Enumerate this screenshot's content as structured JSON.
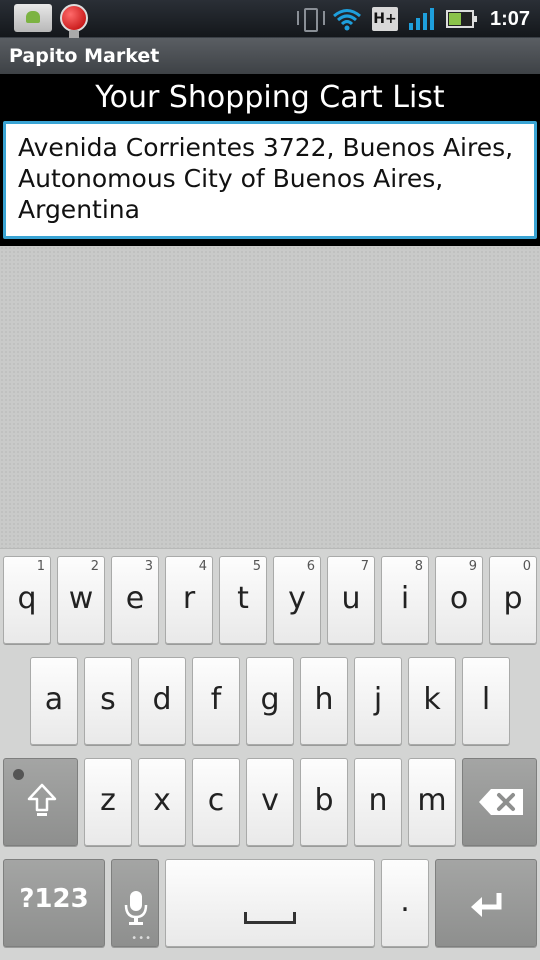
{
  "status_bar": {
    "notification_icons": [
      "photo-icon",
      "globe-icon"
    ],
    "system_icons": [
      "vibrate-icon",
      "wifi-icon",
      "network-type-icon",
      "signal-icon",
      "battery-icon"
    ],
    "network_type": "H+",
    "time": "1:07"
  },
  "app": {
    "title": "Papito Market"
  },
  "main": {
    "page_title": "Your Shopping Cart List",
    "address_lines": [
      "Avenida Corrientes 3722, Buenos Aires,",
      "Autonomous City of Buenos Aires,",
      "Argentina"
    ]
  },
  "keyboard": {
    "row1": [
      {
        "label": "q",
        "hint": "1"
      },
      {
        "label": "w",
        "hint": "2"
      },
      {
        "label": "e",
        "hint": "3"
      },
      {
        "label": "r",
        "hint": "4"
      },
      {
        "label": "t",
        "hint": "5"
      },
      {
        "label": "y",
        "hint": "6"
      },
      {
        "label": "u",
        "hint": "7"
      },
      {
        "label": "i",
        "hint": "8"
      },
      {
        "label": "o",
        "hint": "9"
      },
      {
        "label": "p",
        "hint": "0"
      }
    ],
    "row2": [
      "a",
      "s",
      "d",
      "f",
      "g",
      "h",
      "j",
      "k",
      "l"
    ],
    "row3": [
      "z",
      "x",
      "c",
      "v",
      "b",
      "n",
      "m"
    ],
    "symbols_label": "?123",
    "period_label": ".",
    "icons": {
      "shift": "shift-icon",
      "backspace": "backspace-icon",
      "mic": "microphone-icon",
      "space": "space-icon",
      "enter": "enter-icon"
    },
    "colors": {
      "background": "#d3d4d3",
      "key": "#f5f5f5",
      "function_key": "#9a9b9a",
      "field_border": "#3aa4d4"
    }
  }
}
